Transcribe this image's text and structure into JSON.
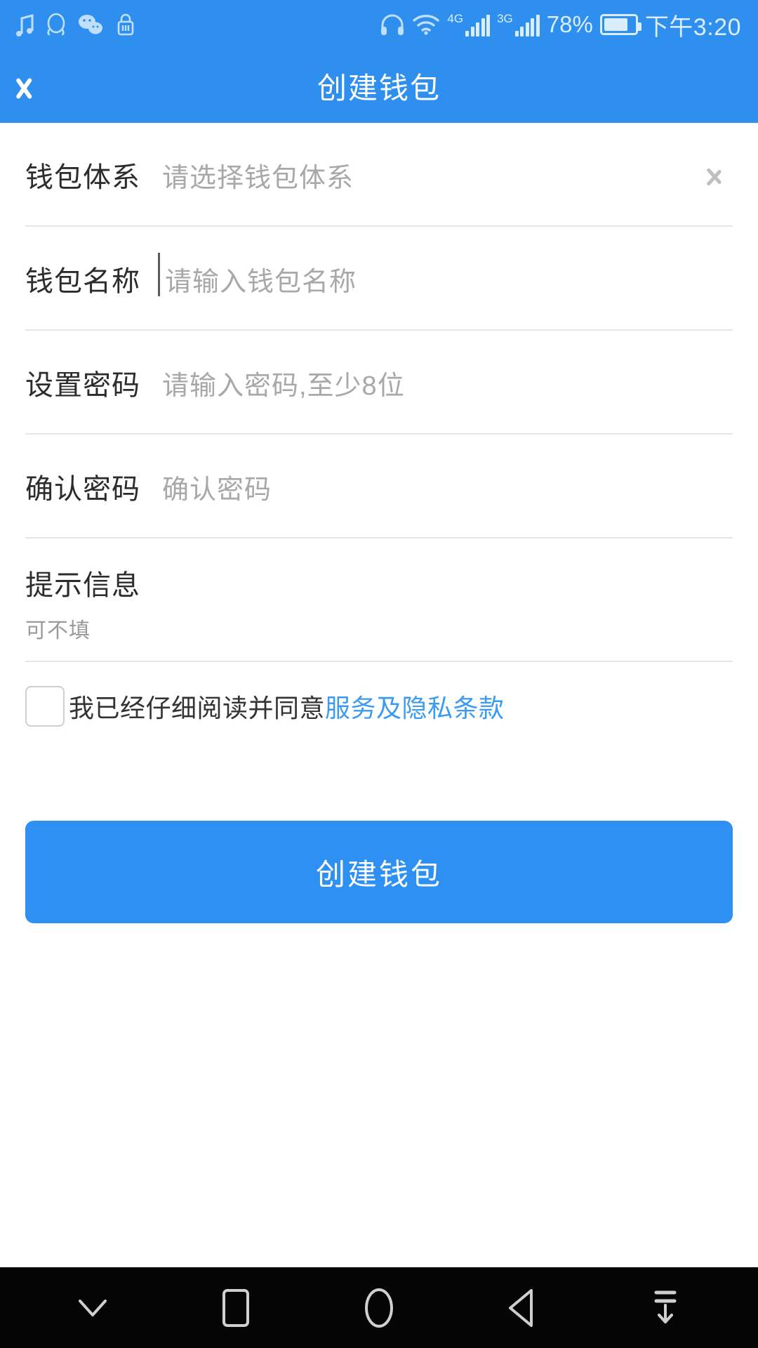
{
  "status_bar": {
    "left_icons": [
      "music-note-icon",
      "qq-penguin-icon",
      "wechat-icon",
      "lock-shop-icon"
    ],
    "right_icons": [
      "headphones-icon",
      "wifi-icon"
    ],
    "network_1": "4G",
    "network_2": "3G",
    "battery_percent": "78%",
    "battery_level": 78,
    "time": "下午3:20"
  },
  "header": {
    "title": "创建钱包",
    "back_icon": "chevron-left-icon"
  },
  "form": {
    "rows": [
      {
        "label": "钱包体系",
        "placeholder": "请选择钱包体系",
        "type": "select",
        "chevron": "chevron-right-icon"
      },
      {
        "label": "钱包名称",
        "placeholder": "请输入钱包名称",
        "type": "text",
        "focused": true
      },
      {
        "label": "设置密码",
        "placeholder": "请输入密码,至少8位",
        "type": "password"
      },
      {
        "label": "确认密码",
        "placeholder": "确认密码",
        "type": "password"
      }
    ],
    "hint": {
      "title": "提示信息",
      "sub": "可不填"
    },
    "terms": {
      "checked": false,
      "text": "我已经仔细阅读并同意",
      "link": "服务及隐私条款"
    },
    "submit_label": "创建钱包"
  },
  "nav_bar": {
    "items": [
      {
        "icon": "chevron-down-icon",
        "name": "collapse-keyboard-button"
      },
      {
        "icon": "square-icon",
        "name": "recents-button"
      },
      {
        "icon": "circle-icon",
        "name": "home-button"
      },
      {
        "icon": "triangle-left-icon",
        "name": "back-button"
      },
      {
        "icon": "hide-navbar-icon",
        "name": "hide-navbar-button"
      }
    ]
  },
  "colors": {
    "brand_blue": "#2E8FEE",
    "button_blue": "#2E90F2",
    "link_blue": "#3A9BF1",
    "divider": "#E6E6E6",
    "placeholder": "#A8A8A8",
    "label": "#2C2C2C"
  }
}
